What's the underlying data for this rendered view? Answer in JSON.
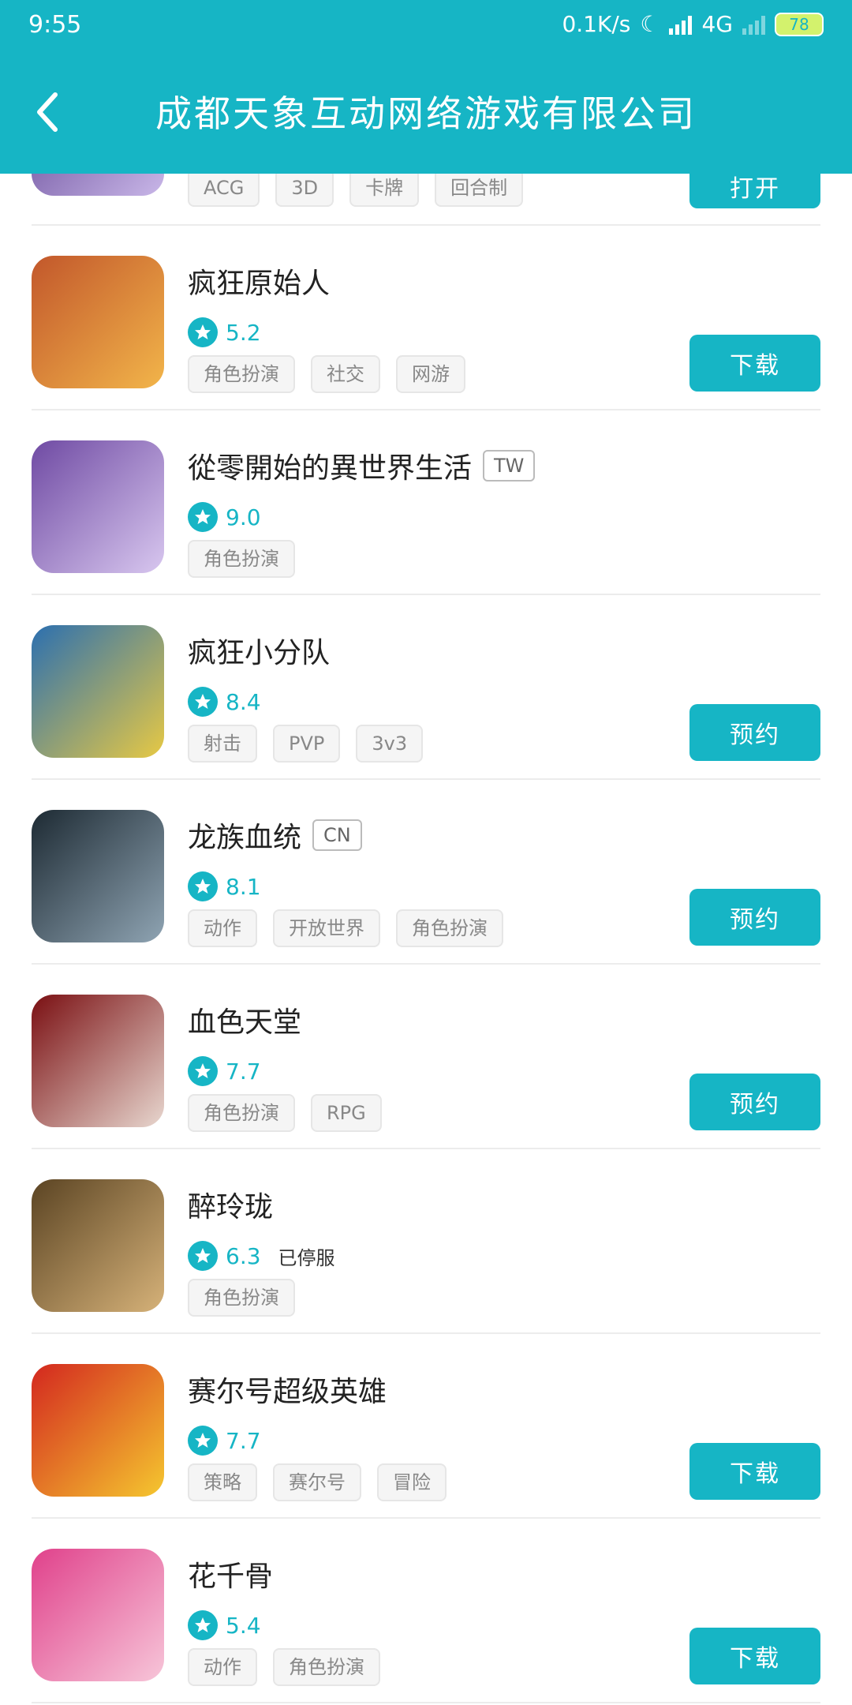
{
  "status_bar": {
    "time": "9:55",
    "speed": "0.1K/s",
    "network": "4G",
    "battery": "78"
  },
  "header": {
    "title": "成都天象互动网络游戏有限公司"
  },
  "partial_row": {
    "tags": [
      "ACG",
      "3D",
      "卡牌",
      "回合制"
    ],
    "action": "打开"
  },
  "games": [
    {
      "name": "疯狂原始人",
      "badge": "",
      "rating": "5.2",
      "note": "",
      "tags": [
        "角色扮演",
        "社交",
        "网游"
      ],
      "action": "下载",
      "colors": [
        "#c2572b",
        "#f2b54a"
      ]
    },
    {
      "name": "從零開始的異世界生活",
      "badge": "TW",
      "rating": "9.0",
      "note": "",
      "tags": [
        "角色扮演"
      ],
      "action": "",
      "colors": [
        "#6f4aa3",
        "#d8c7ef"
      ]
    },
    {
      "name": "疯狂小分队",
      "badge": "",
      "rating": "8.4",
      "note": "",
      "tags": [
        "射击",
        "PVP",
        "3v3"
      ],
      "action": "预约",
      "colors": [
        "#2b6fb0",
        "#e7c944"
      ]
    },
    {
      "name": "龙族血统",
      "badge": "CN",
      "rating": "8.1",
      "note": "",
      "tags": [
        "动作",
        "开放世界",
        "角色扮演"
      ],
      "action": "预约",
      "colors": [
        "#1d2a33",
        "#8fa4b3"
      ]
    },
    {
      "name": "血色天堂",
      "badge": "",
      "rating": "7.7",
      "note": "",
      "tags": [
        "角色扮演",
        "RPG"
      ],
      "action": "预约",
      "colors": [
        "#7a0f12",
        "#e8d7cf"
      ]
    },
    {
      "name": "醉玲珑",
      "badge": "",
      "rating": "6.3",
      "note": "已停服",
      "tags": [
        "角色扮演"
      ],
      "action": "",
      "colors": [
        "#5b4423",
        "#d6b279"
      ]
    },
    {
      "name": "赛尔号超级英雄",
      "badge": "",
      "rating": "7.7",
      "note": "",
      "tags": [
        "策略",
        "赛尔号",
        "冒险"
      ],
      "action": "下载",
      "colors": [
        "#d3271f",
        "#f5c72f"
      ]
    },
    {
      "name": "花千骨",
      "badge": "",
      "rating": "5.4",
      "note": "",
      "tags": [
        "动作",
        "角色扮演"
      ],
      "action": "下载",
      "colors": [
        "#e0418b",
        "#f7c6d9"
      ]
    }
  ]
}
